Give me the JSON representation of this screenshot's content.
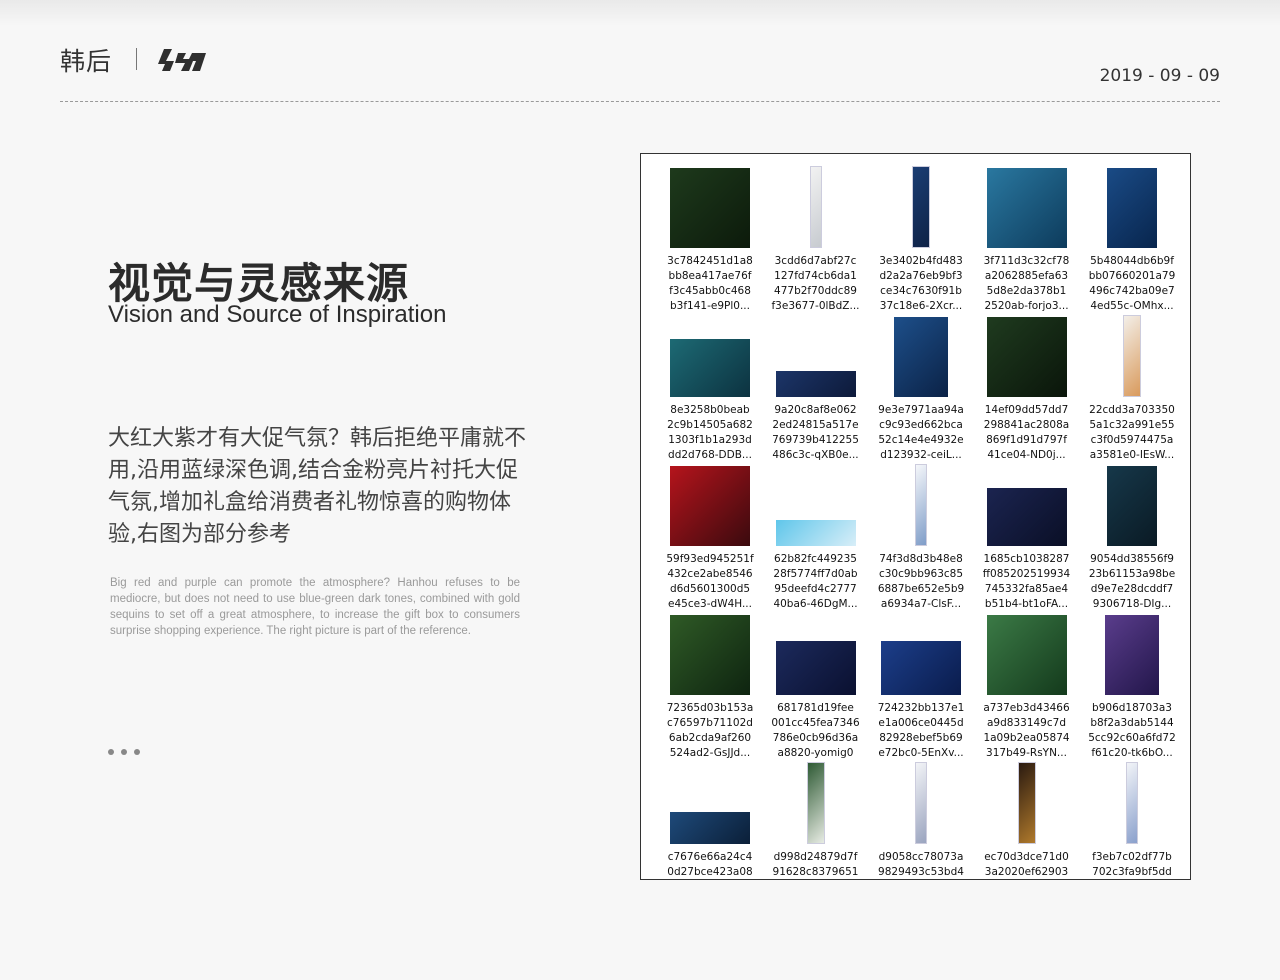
{
  "header": {
    "brand_cn": "韩后",
    "logo_icon": "hanhou-logo-icon",
    "date": "2019 - 09 - 09"
  },
  "main": {
    "title_cn": "视觉与灵感来源",
    "title_en": "Vision and Source of Inspiration",
    "desc_cn": "大红大紫才有大促气氛？韩后拒绝平庸就不用,沿用蓝绿深色调,结合金粉亮片衬托大促气氛,增加礼盒给消费者礼物惊喜的购物体验,右图为部分参考",
    "desc_en": "Big red and purple can promote the atmosphere? Hanhou refuses to be mediocre, but does not need to use blue-green dark tones, combined with gold sequins to set off a great atmosphere, to increase the gift box to consumers surprise shopping experience. The right picture is part of the reference."
  },
  "gallery": {
    "files": [
      {
        "lines": [
          "3c7842451d1a8",
          "bb8ea417ae76f",
          "f3c45abb0c468",
          "b3f141-e9Pl0..."
        ],
        "thumb": {
          "shape": "square",
          "colors": [
            "#1e3a1c",
            "#0c1a0b"
          ]
        }
      },
      {
        "lines": [
          "3cdd6d7abf27c",
          "127fd74cb6da1",
          "477b2f70ddc89",
          "f3e3677-0lBdZ..."
        ],
        "thumb": {
          "shape": "tall",
          "colors": [
            "#f2f2f2",
            "#c7cbd0"
          ]
        }
      },
      {
        "lines": [
          "3e3402b4fd483",
          "d2a2a76eb9bf3",
          "ce34c7630f91b",
          "37c18e6-2Xcr..."
        ],
        "thumb": {
          "shape": "tall-mid",
          "colors": [
            "#1b3d73",
            "#0f2247"
          ]
        }
      },
      {
        "lines": [
          "3f711d3c32cf78",
          "a2062885efa63",
          "5d8e2da378b1",
          "2520ab-forjo3..."
        ],
        "thumb": {
          "shape": "square",
          "colors": [
            "#2a78a0",
            "#0d3b5c"
          ]
        }
      },
      {
        "lines": [
          "5b48044db6b9f",
          "bb07660201a79",
          "496c742ba09e7",
          "4ed55c-OMhx..."
        ],
        "thumb": {
          "shape": "portrait",
          "colors": [
            "#1a4b86",
            "#08254d"
          ]
        }
      },
      {
        "lines": [
          "8e3258b0beab",
          "2c9b14505a682",
          "1303f1b1a293d",
          "dd2d768-DDB..."
        ],
        "thumb": {
          "shape": "wide",
          "colors": [
            "#1d6a74",
            "#0c3240"
          ]
        }
      },
      {
        "lines": [
          "9a20c8af8e062",
          "2ed24815a517e",
          "769739b412255",
          "486c3c-qXB0e..."
        ],
        "thumb": {
          "shape": "banner",
          "colors": [
            "#1c3568",
            "#0d1a3a"
          ]
        }
      },
      {
        "lines": [
          "9e3e7971aa94a",
          "c9c93ed662bca",
          "52c14e4e4932e",
          "d123932-ceiL..."
        ],
        "thumb": {
          "shape": "portrait-wide",
          "colors": [
            "#1d4f8a",
            "#0b2246"
          ]
        }
      },
      {
        "lines": [
          "14ef09dd57dd7",
          "298841ac2808a",
          "869f1d91d797f",
          "41ce04-ND0j..."
        ],
        "thumb": {
          "shape": "square",
          "colors": [
            "#1f3b1f",
            "#0a150a"
          ]
        }
      },
      {
        "lines": [
          "22cdd3a703350",
          "5a1c32a991e55",
          "c3f0d5974475a",
          "a3581e0-IEsW..."
        ],
        "thumb": {
          "shape": "tall-mid",
          "colors": [
            "#f3efe9",
            "#d99a5c"
          ]
        }
      },
      {
        "lines": [
          "59f93ed945251f",
          "432ce2abe8546",
          "d6d5601300d5",
          "e45ce3-dW4H..."
        ],
        "thumb": {
          "shape": "square",
          "colors": [
            "#b5141c",
            "#3a0a0e"
          ]
        }
      },
      {
        "lines": [
          "62b82fc449235",
          "28f5774ff7d0ab",
          "95deefd4c2777",
          "40ba6-46DgM..."
        ],
        "thumb": {
          "shape": "banner",
          "colors": [
            "#5fc6ea",
            "#d8eef8"
          ]
        }
      },
      {
        "lines": [
          "74f3d8d3b48e8",
          "c30c9bb963c85",
          "6887be652e5b9",
          "a6934a7-ClsF..."
        ],
        "thumb": {
          "shape": "tall",
          "colors": [
            "#f5f7fa",
            "#7f9dc8"
          ]
        }
      },
      {
        "lines": [
          "1685cb1038287",
          "ff085202519934",
          "745332fa85ae4",
          "b51b4-bt1oFA..."
        ],
        "thumb": {
          "shape": "wide",
          "colors": [
            "#1b2450",
            "#0a0f26"
          ]
        }
      },
      {
        "lines": [
          "9054dd38556f9",
          "23b61153a98be",
          "d9e7e28dcddf7",
          "9306718-DIg..."
        ],
        "thumb": {
          "shape": "portrait",
          "colors": [
            "#16384a",
            "#0a1a24"
          ]
        }
      },
      {
        "lines": [
          "72365d03b153a",
          "c76597b71102d",
          "6ab2cda9af260",
          "524ad2-GsJJd..."
        ],
        "thumb": {
          "shape": "square",
          "colors": [
            "#2f5a26",
            "#0e2410"
          ]
        }
      },
      {
        "lines": [
          "681781d19fee",
          "001cc45fea7346",
          "786e0cb96d36a",
          "a8820-yomig0"
        ],
        "thumb": {
          "shape": "wide-tall",
          "colors": [
            "#1c2a5c",
            "#0a1030"
          ]
        }
      },
      {
        "lines": [
          "724232bb137e1",
          "e1a006ce0445d",
          "82928ebef5b69",
          "e72bc0-5EnXv..."
        ],
        "thumb": {
          "shape": "wide-tall",
          "colors": [
            "#1c3e8a",
            "#0a1c4c"
          ]
        }
      },
      {
        "lines": [
          "a737eb3d43466",
          "a9d833149c7d",
          "1a09b2ea05874",
          "317b49-RsYN..."
        ],
        "thumb": {
          "shape": "square",
          "colors": [
            "#3b7a46",
            "#143a1c"
          ]
        }
      },
      {
        "lines": [
          "b906d18703a3",
          "b8f2a3dab5144",
          "5cc92c60a6fd72",
          "f61c20-tk6bO..."
        ],
        "thumb": {
          "shape": "portrait-wide",
          "colors": [
            "#5a3d8c",
            "#22164a"
          ]
        }
      },
      {
        "lines": [
          "c7676e66a24c4",
          "0d27bce423a08",
          "",
          ""
        ],
        "thumb": {
          "shape": "banner-tall",
          "colors": [
            "#1e4a7a",
            "#0b1f38"
          ]
        }
      },
      {
        "lines": [
          "d998d24879d7f",
          "91628c8379651",
          "",
          ""
        ],
        "thumb": {
          "shape": "tall-mid",
          "colors": [
            "#2e5a34",
            "#e8ece4"
          ]
        }
      },
      {
        "lines": [
          "d9058cc78073a",
          "9829493c53bd4",
          "",
          ""
        ],
        "thumb": {
          "shape": "tall",
          "colors": [
            "#f3f4f7",
            "#9aa4bf"
          ]
        }
      },
      {
        "lines": [
          "ec70d3dce71d0",
          "3a2020ef62903",
          "",
          ""
        ],
        "thumb": {
          "shape": "tall-mid",
          "colors": [
            "#2a1a10",
            "#b07a2c"
          ]
        }
      },
      {
        "lines": [
          "f3eb7c02df77b",
          "702c3fa9bf5dd",
          "",
          ""
        ],
        "thumb": {
          "shape": "tall",
          "colors": [
            "#f2f4f8",
            "#8aa0cc"
          ]
        }
      }
    ]
  }
}
